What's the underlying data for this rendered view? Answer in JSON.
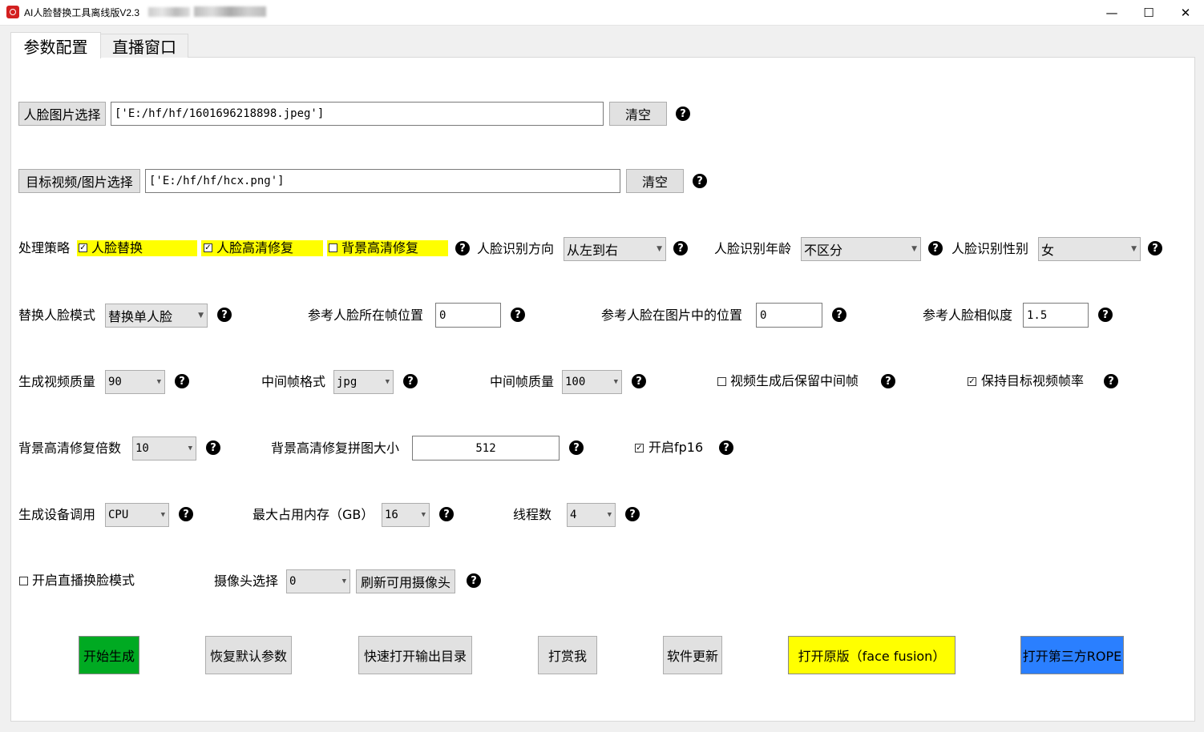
{
  "window": {
    "title": "AI人脸替换工具离线版V2.3",
    "minimize_glyph": "—",
    "maximize_glyph": "☐",
    "close_glyph": "✕"
  },
  "tabs": [
    {
      "label": "参数配置",
      "active": true
    },
    {
      "label": "直播窗口",
      "active": false
    }
  ],
  "help_glyph": "?",
  "face_image": {
    "button_label": "人脸图片选择",
    "value": "['E:/hf/hf/1601696218898.jpeg']",
    "clear_label": "清空"
  },
  "target_media": {
    "button_label": "目标视频/图片选择",
    "value": "['E:/hf/hf/hcx.png']",
    "clear_label": "清空"
  },
  "strategy": {
    "label": "处理策略",
    "options": [
      {
        "label": "人脸替换",
        "checked": true
      },
      {
        "label": "人脸高清修复",
        "checked": true
      },
      {
        "label": "背景高清修复",
        "checked": false
      }
    ],
    "highlight_color": "#ffff00"
  },
  "face_direction": {
    "label": "人脸识别方向",
    "value": "从左到右"
  },
  "face_age": {
    "label": "人脸识别年龄",
    "value": "不区分"
  },
  "face_gender": {
    "label": "人脸识别性别",
    "value": "女"
  },
  "replace_mode": {
    "label": "替换人脸模式",
    "value": "替换单人脸"
  },
  "ref_frame": {
    "label": "参考人脸所在帧位置",
    "value": "0"
  },
  "ref_position": {
    "label": "参考人脸在图片中的位置",
    "value": "0"
  },
  "ref_similarity": {
    "label": "参考人脸相似度",
    "value": "1.5"
  },
  "video_quality": {
    "label": "生成视频质量",
    "value": "90"
  },
  "frame_format": {
    "label": "中间帧格式",
    "value": "jpg"
  },
  "frame_quality": {
    "label": "中间帧质量",
    "value": "100"
  },
  "keep_frames": {
    "label": "视频生成后保留中间帧",
    "checked": false
  },
  "keep_fps": {
    "label": "保持目标视频帧率",
    "checked": true
  },
  "bg_scale": {
    "label": "背景高清修复倍数",
    "value": "10"
  },
  "bg_tile": {
    "label": "背景高清修复拼图大小",
    "value": "512"
  },
  "fp16": {
    "label": "开启fp16",
    "checked": true
  },
  "device": {
    "label": "生成设备调用",
    "value": "CPU"
  },
  "max_memory": {
    "label": "最大占用内存（GB）",
    "value": "16"
  },
  "threads": {
    "label": "线程数",
    "value": "4"
  },
  "live_mode": {
    "label": "开启直播换脸模式",
    "checked": false
  },
  "camera": {
    "label": "摄像头选择",
    "value": "0",
    "refresh_label": "刷新可用摄像头"
  },
  "actions": [
    {
      "id": "start",
      "label": "开始生成",
      "color": "#00aa22"
    },
    {
      "id": "reset",
      "label": "恢复默认参数",
      "color": "#e1e1e1"
    },
    {
      "id": "open-output",
      "label": "快速打开输出目录",
      "color": "#e1e1e1"
    },
    {
      "id": "tip",
      "label": "打赏我",
      "color": "#e1e1e1"
    },
    {
      "id": "update",
      "label": "软件更新",
      "color": "#e1e1e1"
    },
    {
      "id": "open-original",
      "label": "打开原版（face fusion）",
      "color": "#ffff00"
    },
    {
      "id": "open-rope",
      "label": "打开第三方ROPE",
      "color": "#2a7fff"
    }
  ]
}
